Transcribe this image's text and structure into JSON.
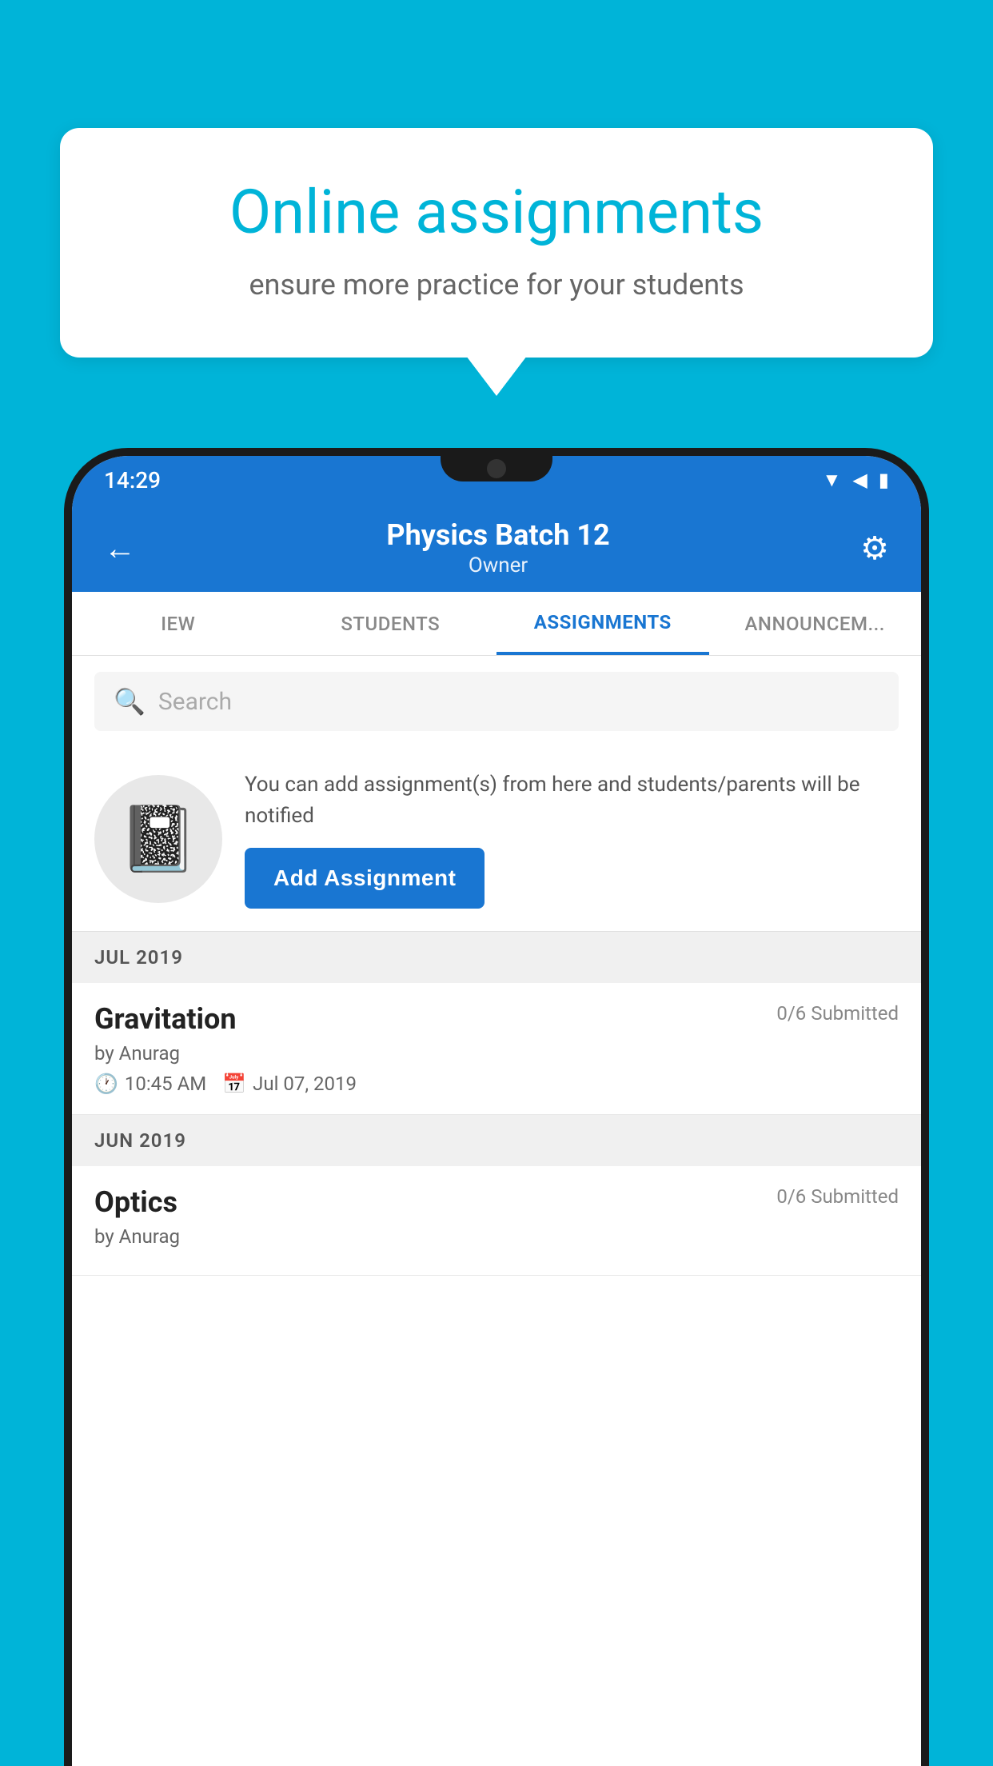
{
  "background_color": "#00b4d8",
  "speech_bubble": {
    "title": "Online assignments",
    "subtitle": "ensure more practice for your students"
  },
  "status_bar": {
    "time": "14:29",
    "wifi": "▲",
    "signal": "▲",
    "battery": "▮"
  },
  "app_bar": {
    "title": "Physics Batch 12",
    "subtitle": "Owner",
    "back_label": "←",
    "settings_label": "⚙"
  },
  "tabs": [
    {
      "label": "IEW",
      "active": false
    },
    {
      "label": "STUDENTS",
      "active": false
    },
    {
      "label": "ASSIGNMENTS",
      "active": true
    },
    {
      "label": "ANNOUNCEM...",
      "active": false
    }
  ],
  "search": {
    "placeholder": "Search"
  },
  "promo": {
    "text": "You can add assignment(s) from here and students/parents will be notified",
    "button_label": "Add Assignment"
  },
  "sections": [
    {
      "header": "JUL 2019",
      "assignments": [
        {
          "title": "Gravitation",
          "submitted": "0/6 Submitted",
          "by": "by Anurag",
          "time": "10:45 AM",
          "date": "Jul 07, 2019"
        }
      ]
    },
    {
      "header": "JUN 2019",
      "assignments": [
        {
          "title": "Optics",
          "submitted": "0/6 Submitted",
          "by": "by Anurag",
          "time": "",
          "date": ""
        }
      ]
    }
  ]
}
